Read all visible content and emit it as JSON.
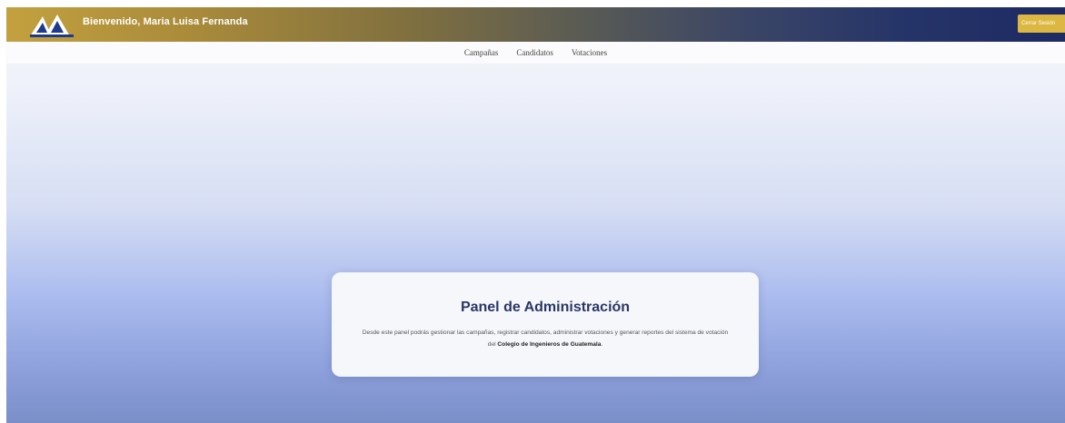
{
  "header": {
    "welcome_text": "Bienvenido, Maria Luisa Fernanda",
    "logout_label": "Cerrar Sesión",
    "logo_icon": "cig-logo-icon",
    "colors": {
      "gradient_start": "#c3a13f",
      "gradient_end": "#1d2a63",
      "logout_bg": "#dcb842"
    }
  },
  "nav": {
    "items": [
      {
        "label": "Campañas"
      },
      {
        "label": "Candidatos"
      },
      {
        "label": "Votaciones"
      }
    ]
  },
  "panel": {
    "title": "Panel de Administración",
    "description_prefix": "Desde este panel podrás gestionar las campañas, registrar candidatos, administrar votaciones y generar reportes del sistema de votación del ",
    "description_bold": "Colegio de Ingenieros de Guatemala",
    "description_suffix": "."
  }
}
